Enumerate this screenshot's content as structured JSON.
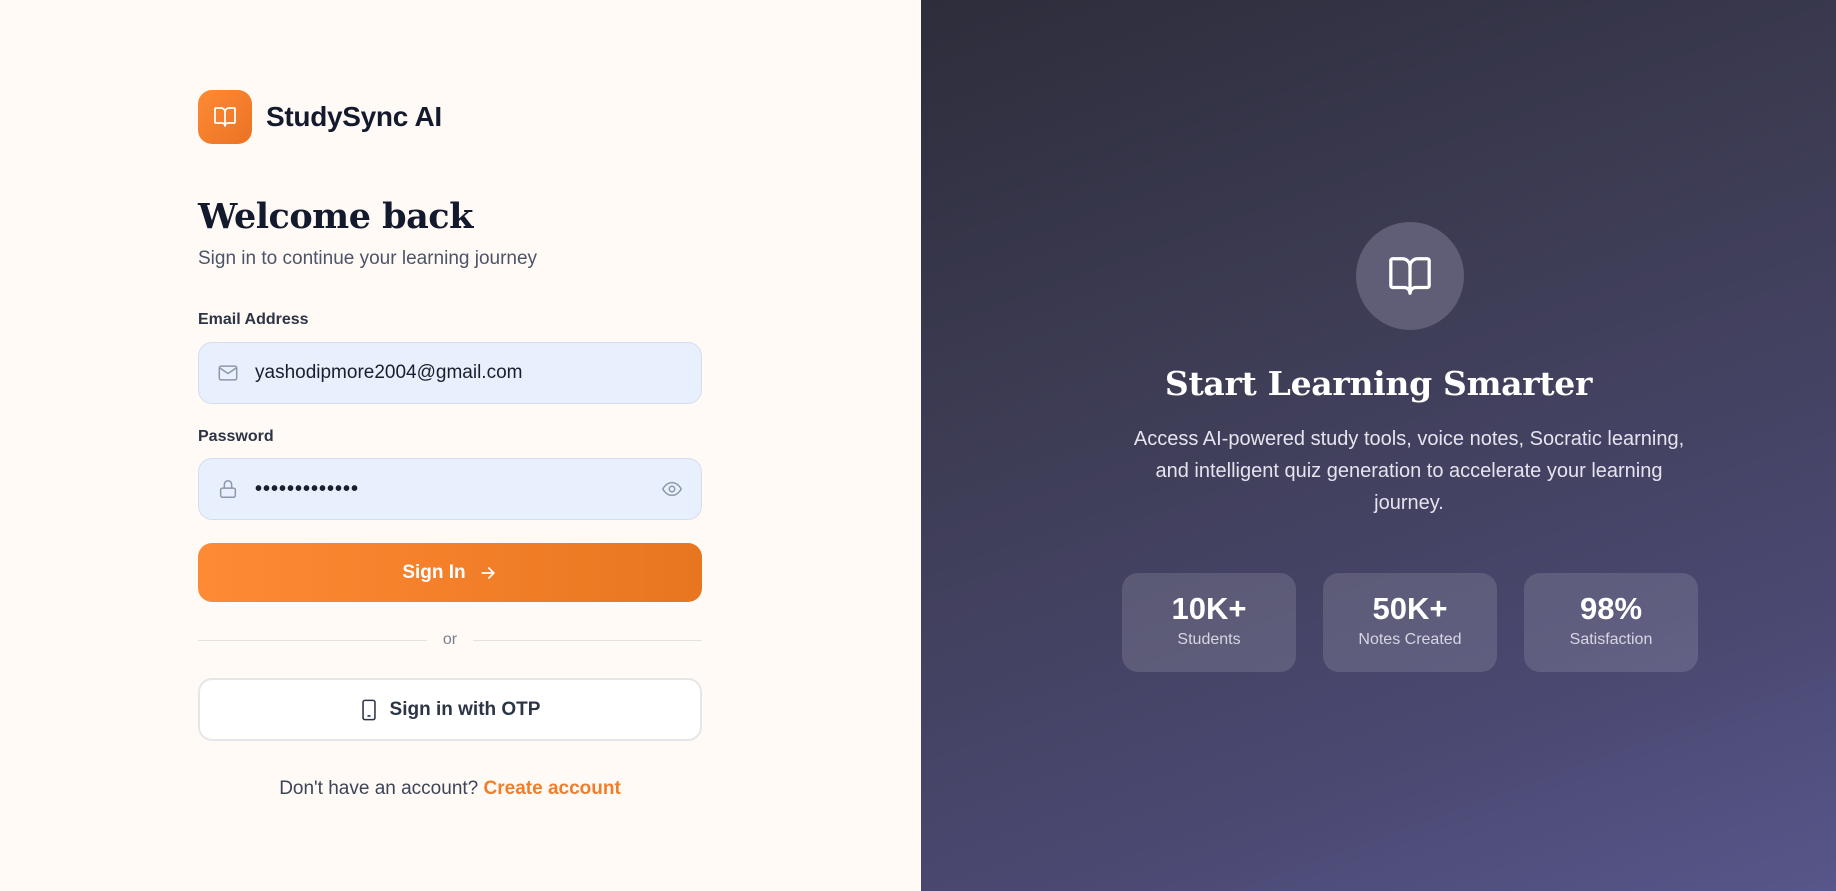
{
  "brand": {
    "name": "StudySync AI",
    "logo_icon": "book-open-icon",
    "accent": "#f7802e"
  },
  "login": {
    "title": "Welcome back",
    "subtitle": "Sign in to continue your learning journey",
    "email": {
      "label": "Email Address",
      "value": "yashodipmore2004@gmail.com",
      "icon": "mail-icon"
    },
    "password": {
      "label": "Password",
      "masked_value": "•••••••••••••",
      "icon": "lock-icon",
      "toggle_icon": "eye-icon"
    },
    "signin_button": "Sign In",
    "divider_text": "or",
    "otp_button": "Sign in with OTP",
    "signup_prompt": "Don't have an account?",
    "signup_link": "Create account"
  },
  "hero": {
    "icon": "book-open-icon",
    "title": "Start Learning Smarter",
    "description": "Access AI-powered study tools, voice notes, Socratic learning, and intelligent quiz generation to accelerate your learning journey.",
    "stats": [
      {
        "value": "10K+",
        "label": "Students"
      },
      {
        "value": "50K+",
        "label": "Notes Created"
      },
      {
        "value": "98%",
        "label": "Satisfaction"
      }
    ]
  }
}
